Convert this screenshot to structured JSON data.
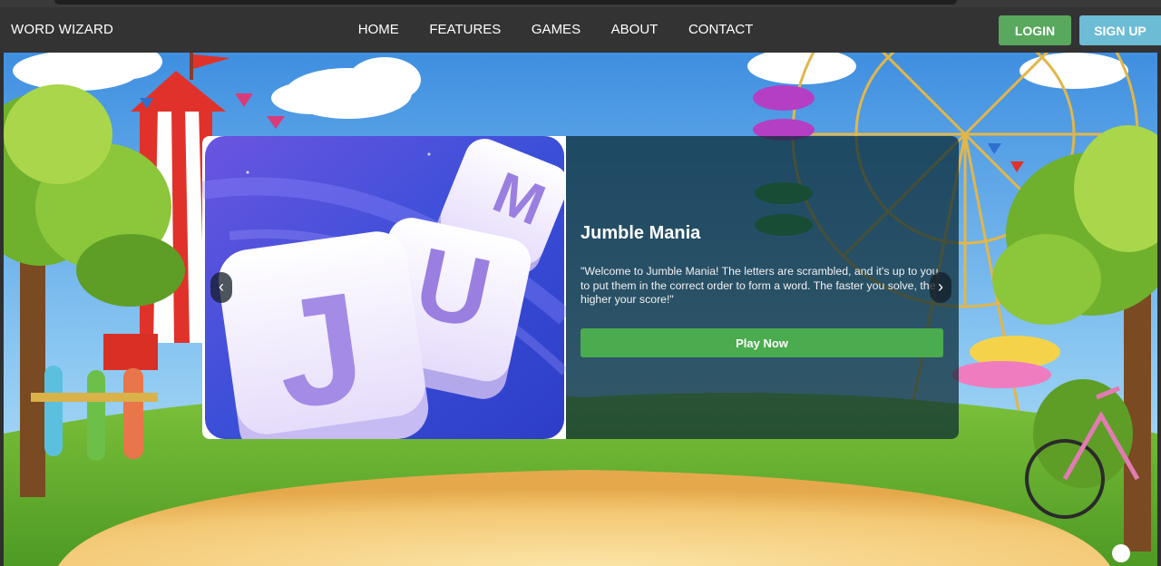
{
  "header": {
    "brand": "WORD WIZARD",
    "nav": [
      "HOME",
      "FEATURES",
      "GAMES",
      "ABOUT",
      "CONTACT"
    ],
    "login_label": "LOGIN",
    "signup_label": "SIGN UP"
  },
  "carousel": {
    "prev_symbol": "‹",
    "next_symbol": "›",
    "slide": {
      "title": "Jumble Mania",
      "description": "\"Welcome to Jumble Mania! The letters are scrambled, and it's up to you to put them in the correct order to form a word. The faster you solve, the higher your score!\"",
      "play_label": "Play Now",
      "tiles": [
        "J",
        "U",
        "M"
      ]
    }
  },
  "colors": {
    "navbar": "#333333",
    "login": "#5aa85e",
    "signup": "#6dbcd6",
    "play": "#4aac4e"
  }
}
